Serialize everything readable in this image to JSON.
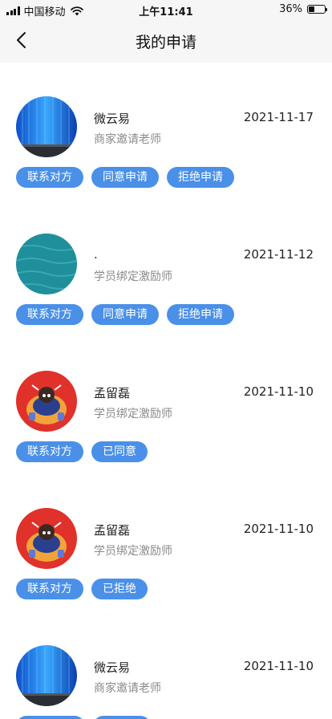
{
  "status_bar": {
    "carrier": "中国移动",
    "time": "上午11:41",
    "battery_label": "36%",
    "battery_level": 0.36
  },
  "nav": {
    "title": "我的申请",
    "back_icon": "chevron-left-icon"
  },
  "colors": {
    "accent": "#4a90e8",
    "header_bg": "#f6f6f6",
    "secondary_text": "#8a8a8a"
  },
  "applications": [
    {
      "name": "微云易",
      "role": "商家邀请老师",
      "date": "2021-11-17",
      "avatar": "screen-avatar",
      "actions": [
        "联系对方",
        "同意申请",
        "拒绝申请"
      ]
    },
    {
      "name": ".",
      "role": "学员绑定激励师",
      "date": "2021-11-12",
      "avatar": "water-avatar",
      "actions": [
        "联系对方",
        "同意申请",
        "拒绝申请"
      ]
    },
    {
      "name": "孟留磊",
      "role": "学员绑定激励师",
      "date": "2021-11-10",
      "avatar": "cartoon-avatar",
      "actions": [
        "联系对方",
        "已同意"
      ]
    },
    {
      "name": "孟留磊",
      "role": "学员绑定激励师",
      "date": "2021-11-10",
      "avatar": "cartoon-avatar",
      "actions": [
        "联系对方",
        "已拒绝"
      ]
    },
    {
      "name": "微云易",
      "role": "商家邀请老师",
      "date": "2021-11-10",
      "avatar": "screen-avatar",
      "actions": [
        "",
        ""
      ]
    }
  ]
}
